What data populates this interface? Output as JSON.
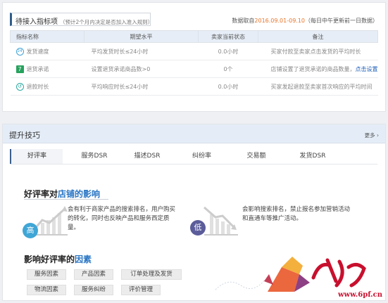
{
  "indicators": {
    "title": "待接入指标项",
    "subtitle": "（预计2个月内决定是否加入准入规则）",
    "source_label": "数据取自",
    "date_range": "2016.09.01-09.10",
    "update_note": "（每日中午更新前一日数据）",
    "columns": [
      "指标名称",
      "期望水平",
      "卖家当前状态",
      "备注"
    ],
    "rows": [
      {
        "icon": "24-hour-icon",
        "icon_text": "24",
        "name": "发货速度",
        "expected": "平均发货时长≤24小时",
        "status": "0.0小时",
        "note": "买家付款至卖家点击发货的平均时长",
        "link": ""
      },
      {
        "icon": "seven-day-return-icon",
        "icon_text": "7",
        "name": "退货承诺",
        "expected": "设置退货承诺商品数>0",
        "status": "0个",
        "note": "店铺设置了退货承诺的商品数量，",
        "link": "点击设置"
      },
      {
        "icon": "refund-clock-icon",
        "icon_text": "↺",
        "name": "退款时长",
        "expected": "平均响应时长≤24小时",
        "status": "0.0小时",
        "note": "买家发起退款至卖家首次响应的平均时间",
        "link": ""
      }
    ]
  },
  "tips": {
    "title": "提升技巧",
    "more": "更多 ›",
    "tabs": [
      "好评率",
      "服务DSR",
      "描述DSR",
      "纠纷率",
      "交易额",
      "发货DSR"
    ],
    "impact_title_pre": "好评率对",
    "impact_title_hl": "店铺的影响",
    "high_badge": "高",
    "low_badge": "低",
    "high_text": "会有利于商家产品的搜索排名，用户购买的转化，同时也反映产品和服务西定质量。",
    "low_text": "会影响搜索排名，禁止报名参加营销活动和直通车等推广活动。",
    "factors_title_pre": "影响好评率的",
    "factors_title_hl": "因素",
    "factors": [
      "服务因素",
      "产品因素",
      "订单处理及发货",
      "物流因素",
      "服务纠纷",
      "评价管理"
    ]
  },
  "watermark": {
    "text": "www.6pf.cn"
  },
  "colors": {
    "accent_blue": "#2a76c4",
    "orange": "#e8742a",
    "high_badge": "#3fa6d6",
    "low_badge": "#5b5c9a"
  }
}
